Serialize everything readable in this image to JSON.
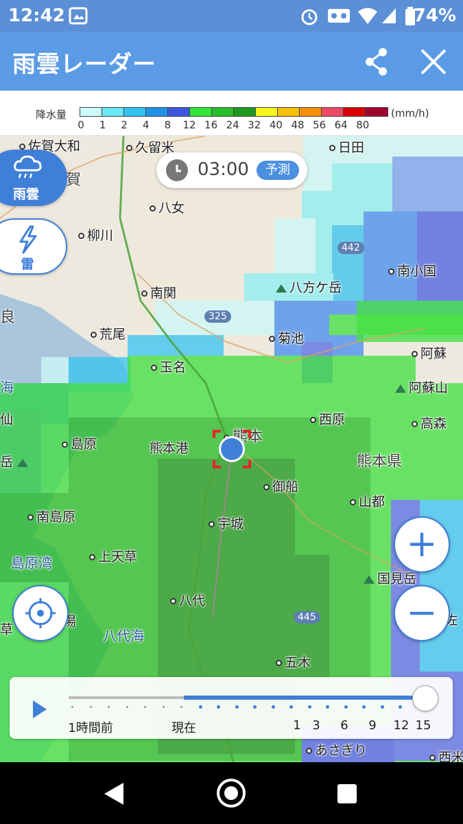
{
  "status_bar": {
    "time": "12:42",
    "battery": "74%",
    "icons": [
      "image-icon",
      "alarm-icon",
      "voicemail-icon",
      "wifi-icon",
      "signal-icon",
      "battery-icon"
    ]
  },
  "app_bar": {
    "title": "雨雲レーダー",
    "share_icon": "share-icon",
    "close_icon": "close-icon"
  },
  "legend": {
    "label": "降水量",
    "unit": "(mm/h)",
    "colors": [
      "#ccfbfb",
      "#66e8f6",
      "#2fc3f2",
      "#1f93e8",
      "#3b58e0",
      "#33e633",
      "#2abd2a",
      "#1f9920",
      "#f5f520",
      "#f5c000",
      "#f58f00",
      "#ec4a64",
      "#d80000",
      "#a00030"
    ],
    "ticks": [
      "0",
      "1",
      "2",
      "4",
      "8",
      "12",
      "16",
      "24",
      "32",
      "40",
      "48",
      "56",
      "64",
      "80"
    ]
  },
  "time_display": {
    "time": "03:00",
    "badge": "予測"
  },
  "modes": {
    "rain": "雨雲",
    "thunder": "雷"
  },
  "map": {
    "places": [
      "佐賀大和",
      "久留米",
      "日田",
      "賀",
      "八女",
      "柳川",
      "南小国",
      "八方ケ岳",
      "南関",
      "良",
      "荒尾",
      "菊池",
      "阿蘇",
      "玉名",
      "海",
      "阿蘇山",
      "西原",
      "熊本",
      "高森",
      "仙",
      "島原",
      "熊本港",
      "熊本県",
      "岳",
      "御船",
      "山都",
      "南島原",
      "宇城",
      "島原湾",
      "上天草",
      "国見岳",
      "八代",
      "八代海",
      "草",
      "五木",
      "あさぎり",
      "西米",
      "佐",
      "湯"
    ],
    "routes": [
      "442",
      "325",
      "445"
    ]
  },
  "zoom": {
    "in": "+",
    "out": "−"
  },
  "timeline": {
    "labels": [
      "1時間前",
      "現在",
      "1",
      "3",
      "6",
      "9",
      "12",
      "15"
    ]
  }
}
